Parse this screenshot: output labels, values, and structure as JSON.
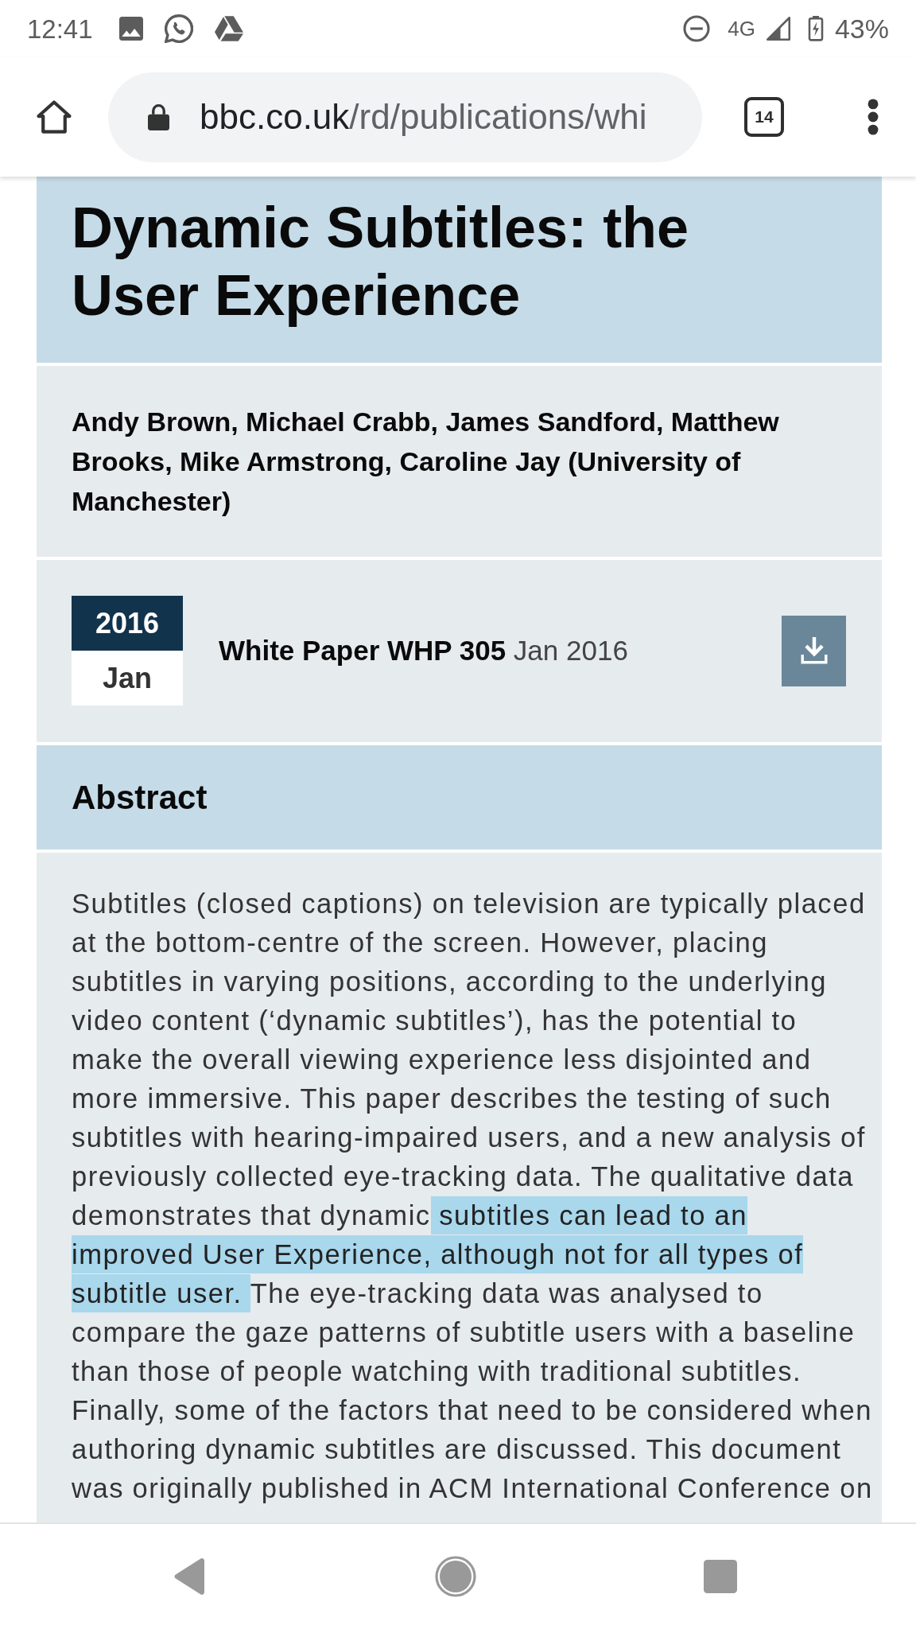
{
  "status_bar": {
    "time": "12:41",
    "network": "4G",
    "battery": "43%"
  },
  "browser_toolbar": {
    "url_domain": "bbc.co.uk",
    "url_path": "/rd/publications/whi",
    "tab_count": "14"
  },
  "article": {
    "title": "Dynamic Subtitles: the User Experience",
    "authors": "Andy Brown, Michael Crabb, James Sandford, Matthew Brooks, Mike Armstrong, Caroline Jay (University of Manchester)",
    "date_badge": {
      "year": "2016",
      "month": "Jan"
    },
    "publication": "**White Paper WHP 305** Jan 2016",
    "abstract": {
      "heading": "Abstract",
      "text_before": "Subtitles (closed captions) on television are typically placed at the bottom-centre of the screen. However, placing subtitles in varying positions, according to the underlying video content (‘dynamic subtitles’), has the potential to make the overall viewing experience less disjointed and more immersive. This paper describes the testing of such subtitles with hearing-impaired users, and a new analysis of previously collected eye-tracking data. The qualitative data demonstrates that dynamic",
      "selected_text": "subtitles can lead to an improved User Experience, although not for all types of subtitle user.",
      "text_after": "The eye-tracking data was analysed to compare the gaze patterns of subtitle users with a baseline than those of people watching with traditional subtitles. Finally, some of the factors that need to be considered when authoring dynamic subtitles are discussed. This document was originally published in ACM International Conference on"
    }
  }
}
